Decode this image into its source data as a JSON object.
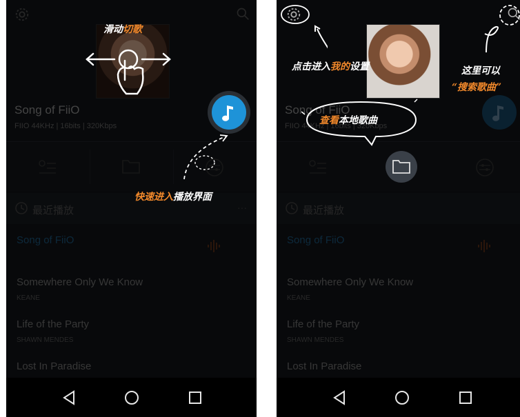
{
  "screens": [
    {
      "song": {
        "title": "Song of FiiO",
        "meta": "FIIO 44KHz | 16bits | 320Kbps"
      },
      "recent": {
        "label": "最近播放",
        "more": "···"
      },
      "list": [
        {
          "title": "Song of FiiO",
          "artist": "",
          "active": true
        },
        {
          "title": "Somewhere Only We Know",
          "artist": "KEANE"
        },
        {
          "title": "Life of the Party",
          "artist": "SHAWN MENDES"
        },
        {
          "title": "Lost In Paradise",
          "artist": ""
        }
      ],
      "annotations": {
        "swipe_w": "滑动",
        "swipe_o": "切歌",
        "quick_o": "快速进入",
        "quick_w": "播放界面"
      }
    },
    {
      "song": {
        "title": "Song of FiiO",
        "meta": "FIIO 44KHz | 16bits | 320Kbps"
      },
      "recent": {
        "label": "最近播放",
        "more": "···"
      },
      "list": [
        {
          "title": "Song of FiiO",
          "artist": "",
          "active": true
        },
        {
          "title": "Somewhere Only We Know",
          "artist": "KEANE"
        },
        {
          "title": "Life of the Party",
          "artist": "SHAWN MENDES"
        },
        {
          "title": "Lost In Paradise",
          "artist": ""
        }
      ],
      "annotations": {
        "settings_w1": "点击进入",
        "settings_o": "我的",
        "settings_w2": "设置",
        "search_w": "这里可以",
        "search_o": "“搜索歌曲”",
        "browse_o": "查看",
        "browse_w": "本地歌曲"
      }
    }
  ],
  "colors": {
    "accent": "#1e93d8",
    "annotation_orange": "#f2892b",
    "active_song": "#1d5c86"
  },
  "icons": [
    "gear-icon",
    "search-icon",
    "music-note-icon",
    "playlist-icon",
    "folder-icon",
    "equalizer-icon",
    "clock-icon",
    "back-icon",
    "home-icon",
    "recents-icon",
    "waveform-icon"
  ]
}
